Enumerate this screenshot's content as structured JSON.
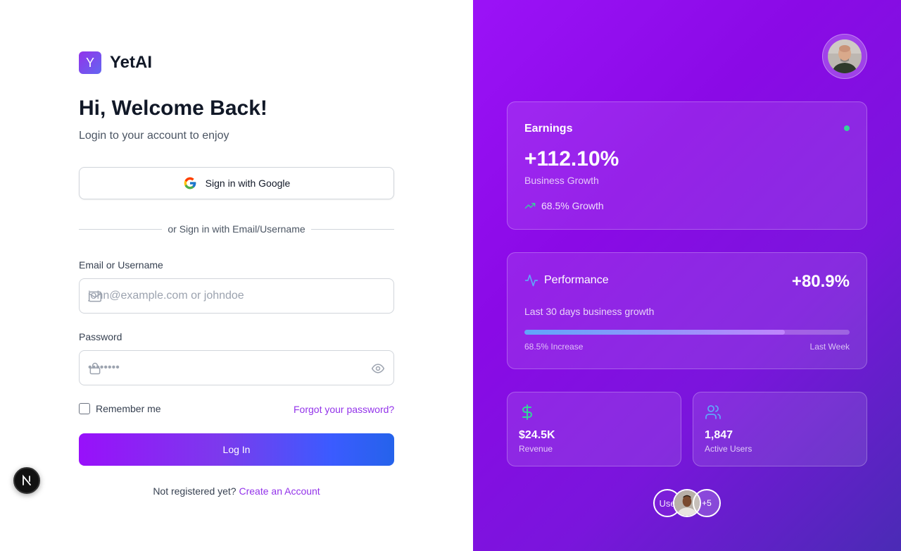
{
  "brand": {
    "logo_letter": "Y",
    "name": "YetAI"
  },
  "login": {
    "heading": "Hi, Welcome Back!",
    "subheading": "Login to your account to enjoy",
    "google_button": "Sign in with Google",
    "divider_text": "or Sign in with Email/Username",
    "email_label": "Email or Username",
    "email_placeholder": "john@example.com or johndoe",
    "password_label": "Password",
    "password_placeholder": "••••••••",
    "remember_label": "Remember me",
    "forgot_link": "Forgot your password?",
    "login_button": "Log In",
    "register_text": "Not registered yet?",
    "register_link": "Create an Account"
  },
  "dev_badge": {
    "letter": "N"
  },
  "dashboard": {
    "earnings": {
      "title": "Earnings",
      "value": "+112.10%",
      "subtitle": "Business Growth",
      "growth": "68.5% Growth"
    },
    "performance": {
      "title": "Performance",
      "value": "+80.9%",
      "description": "Last 30 days business growth",
      "progress_fraction": 0.8,
      "bar_left_label": "68.5% Increase",
      "bar_right_label": "Last Week"
    },
    "revenue": {
      "value": "$24.5K",
      "label": "Revenue"
    },
    "users": {
      "value": "1,847",
      "label": "Active Users"
    },
    "avatars": {
      "broken_alt": "Use",
      "more": "+5"
    }
  },
  "colors": {
    "accent": "#9333ea",
    "green_dot": "#34d399",
    "login_gradient_start": "#9810fa",
    "login_gradient_end": "#2563eb"
  },
  "icons": [
    "google-icon",
    "mail-icon",
    "lock-icon",
    "eye-icon",
    "trending-up-icon",
    "activity-icon",
    "dollar-icon",
    "users-icon"
  ]
}
